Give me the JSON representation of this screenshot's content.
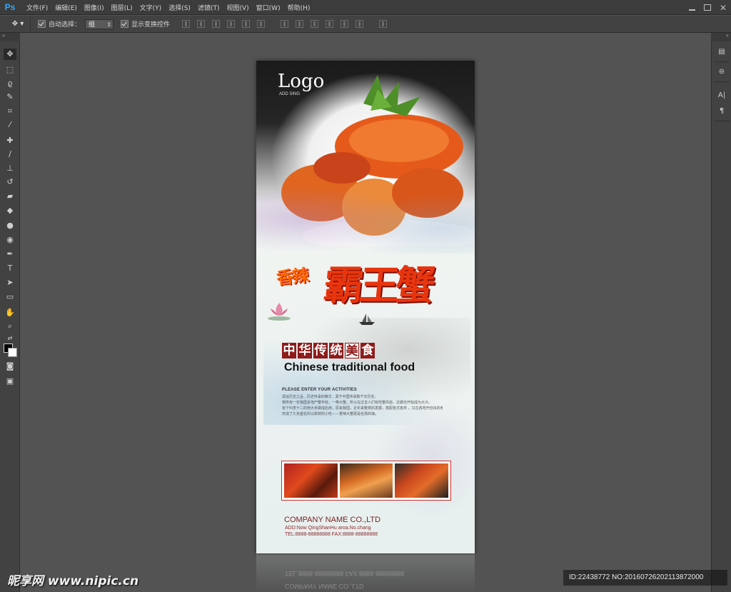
{
  "app": {
    "logo": "Ps"
  },
  "menu": [
    "文件(F)",
    "编辑(E)",
    "图像(I)",
    "图层(L)",
    "文字(Y)",
    "选择(S)",
    "滤镜(T)",
    "视图(V)",
    "窗口(W)",
    "帮助(H)"
  ],
  "options": {
    "auto_select_label": "自动选择：",
    "auto_select_value": "组",
    "show_transform_label": "显示变换控件"
  },
  "toolbar": {
    "collapse": "»",
    "tools": [
      "move-icon",
      "marquee-icon",
      "lasso-icon",
      "quick-select-icon",
      "crop-icon",
      "eyedropper-icon",
      "healing-brush-icon",
      "brush-icon",
      "clone-stamp-icon",
      "history-brush-icon",
      "eraser-icon",
      "paint-bucket-icon",
      "blur-icon",
      "dodge-icon",
      "pen-icon",
      "type-icon",
      "path-select-icon",
      "rectangle-icon",
      "hand-icon",
      "zoom-icon"
    ],
    "foreground": "#000000",
    "background": "#ffffff"
  },
  "panels": {
    "collapse": "»",
    "icons": [
      "history-icon",
      "properties-icon",
      "character-icon",
      "paragraph-icon"
    ]
  },
  "poster": {
    "logo": "Logo",
    "logo_sub": "ADD SING",
    "tag_small": "香辣",
    "title_big": "霸王蟹",
    "cn_banner": [
      "中",
      "华",
      "传",
      "统",
      "美",
      "食"
    ],
    "en_title": "Chinese traditional food",
    "enter_title": "PLEASE ENTER YOUR ACTIVITIES",
    "body_lines": [
      "源远历史之品 , 历史传承的精华 , 源于中国传承数千年历史。",
      "相传有一年我国多地产蟹丰收，一带大蟹，所以在过去人们有吃蟹风俗，近期也开始成为大众。",
      "有个叫李十二的用大米做成后用，原来我国，近年来蟹类的发展，搭配各式各样 ，又在各地开创出的食用。",
      "形成了久负盛名的以新鲜的小吃——香辣大蟹更是名扬四海。"
    ],
    "company": "COMPANY NAME CO.,LTD",
    "address": "ADD:Now QingShanHu aroa.No.chang",
    "phone": "TEL:8888-88888888  FAX:8888-88888888",
    "colors": {
      "accent_red": "#8f1b1b",
      "title_red": "#e8350e",
      "orange": "#ff6a00"
    }
  },
  "reflection": {
    "line1": "TEL:8888-88888888  FAX:8888-88888888",
    "line2": "COMPANY NAME CO.,LTD"
  },
  "watermark": "昵享网 www.nipic.cn",
  "image_id": "ID:22438772 NO:20160726202113872000"
}
